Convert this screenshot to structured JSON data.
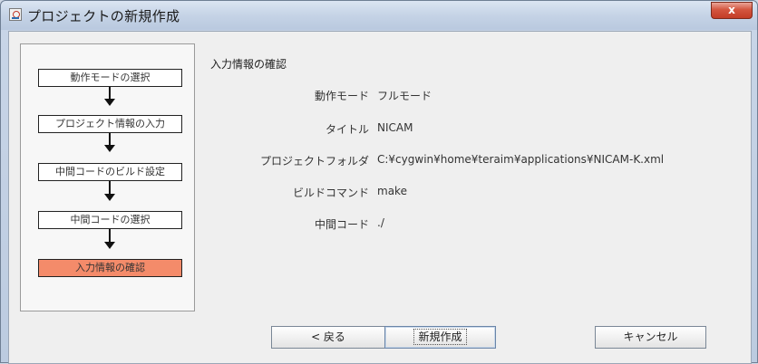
{
  "window": {
    "title": "プロジェクトの新規作成",
    "close_label": "x"
  },
  "steps": [
    {
      "label": "動作モードの選択",
      "active": false
    },
    {
      "label": "プロジェクト情報の入力",
      "active": false
    },
    {
      "label": "中間コードのビルド設定",
      "active": false
    },
    {
      "label": "中間コードの選択",
      "active": false
    },
    {
      "label": "入力情報の確認",
      "active": true
    }
  ],
  "summary": {
    "title": "入力情報の確認",
    "fields": [
      {
        "label": "動作モード",
        "value": "フルモード"
      },
      {
        "label": "タイトル",
        "value": "NICAM"
      },
      {
        "label": "プロジェクトフォルダ",
        "value": "C:¥cygwin¥home¥teraim¥applications¥NICAM-K.xml"
      },
      {
        "label": "ビルドコマンド",
        "value": "make"
      },
      {
        "label": "中間コード",
        "value": "./"
      }
    ]
  },
  "buttons": {
    "back": "< 戻る",
    "create": "新規作成",
    "cancel": "キャンセル"
  },
  "colors": {
    "active_step": "#f48b6a",
    "close_button": "#c9442d"
  }
}
